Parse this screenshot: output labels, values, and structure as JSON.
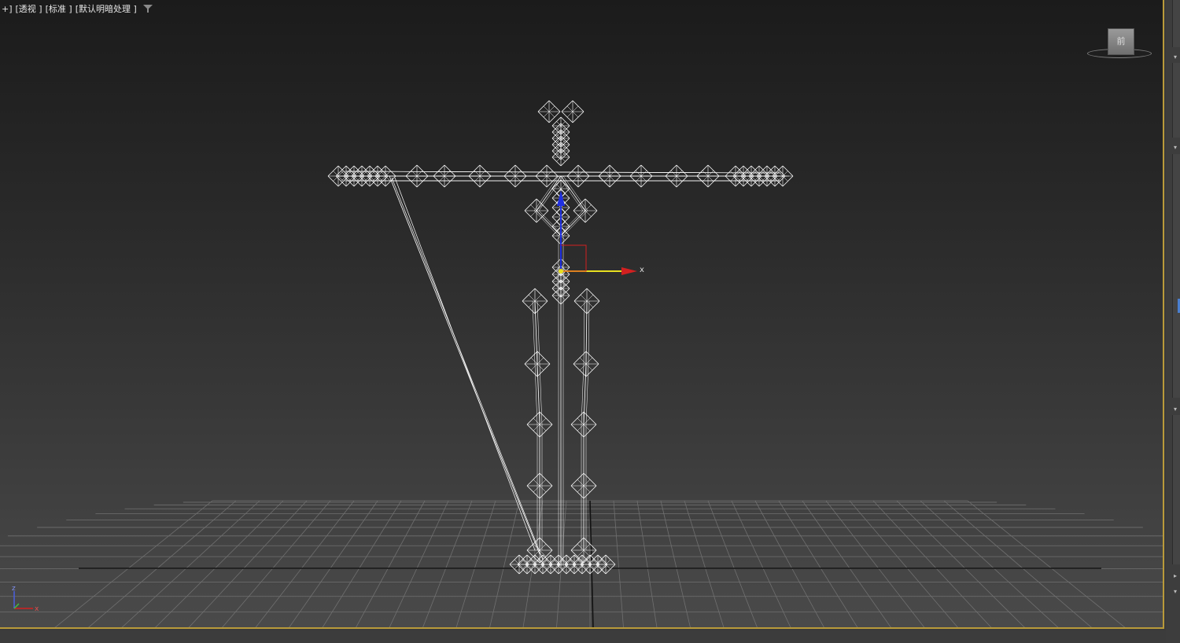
{
  "viewport": {
    "labels": [
      "+]",
      "[透视 ]",
      "[标准 ]",
      "[默认明暗处理 ]"
    ],
    "viewcube_face": "前",
    "gizmo_axis_label": "x",
    "axis_tripod": {
      "z": "z",
      "x": "x"
    }
  },
  "icons": [
    "filter-icon",
    "viewcube-icon",
    "transform-gizmo-icon",
    "axis-tripod-icon"
  ],
  "colors": {
    "viewport_border": "#b99a3a",
    "gizmo_x": "#d22020",
    "gizmo_y": "#e8e020",
    "gizmo_z": "#2030e0",
    "wireframe": "#ffffff",
    "panel_accent": "#4a7fcf"
  }
}
